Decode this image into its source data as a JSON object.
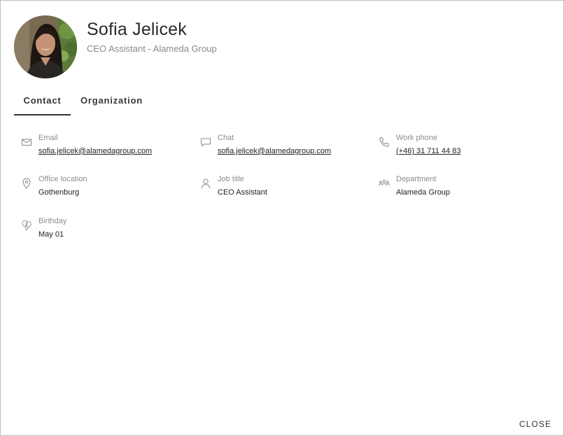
{
  "profile": {
    "name": "Sofia Jelicek",
    "subtitle": "CEO Assistant - Alameda Group"
  },
  "tabs": [
    {
      "label": "Contact",
      "active": true
    },
    {
      "label": "Organization",
      "active": false
    }
  ],
  "fields": {
    "email": {
      "label": "Email",
      "value": "sofia.jelicek@alamedagroup.com",
      "icon": "mail-icon"
    },
    "chat": {
      "label": "Chat",
      "value": "sofia.jelicek@alamedagroup.com",
      "icon": "chat-icon"
    },
    "work_phone": {
      "label": "Work phone",
      "value": "(+46) 31 711 44 83",
      "icon": "phone-icon"
    },
    "office_location": {
      "label": "Office location",
      "value": "Gothenburg",
      "icon": "location-pin-icon"
    },
    "job_title": {
      "label": "Job title",
      "value": "CEO Assistant",
      "icon": "person-icon"
    },
    "department": {
      "label": "Department",
      "value": "Alameda Group",
      "icon": "team-icon"
    },
    "birthday": {
      "label": "Birthday",
      "value": "May 01",
      "icon": "balloons-icon"
    }
  },
  "footer": {
    "close_label": "CLOSE"
  },
  "colors": {
    "border": "#bdbdbd",
    "label_gray": "#8c8c8c",
    "text_dark": "#222222",
    "tab_underline": "#333333"
  }
}
